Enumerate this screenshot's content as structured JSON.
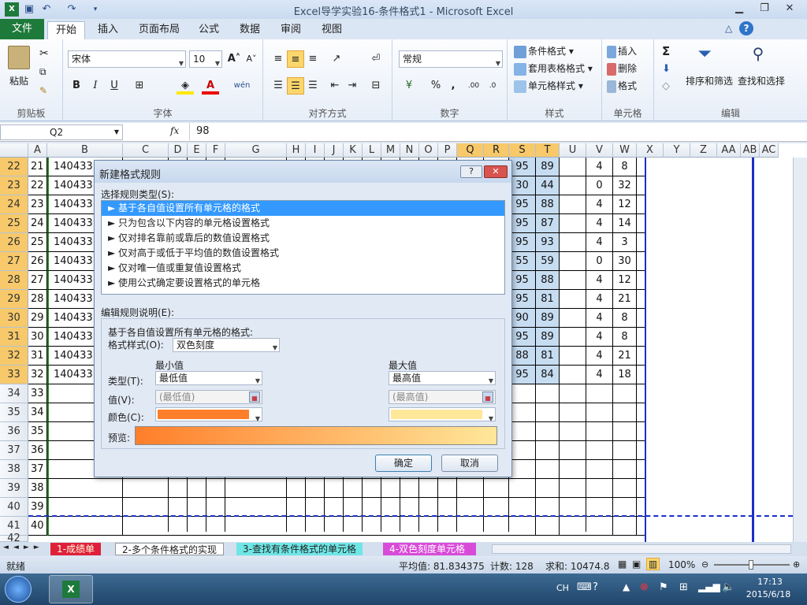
{
  "window": {
    "title": "Excel导学实验16-条件格式1  -  Microsoft Excel"
  },
  "tabs": [
    "文件",
    "开始",
    "插入",
    "页面布局",
    "公式",
    "数据",
    "审阅",
    "视图"
  ],
  "ribbon": {
    "clipboard": {
      "label": "剪贴板",
      "paste": "粘贴"
    },
    "font": {
      "label": "字体",
      "name": "宋体",
      "size": "10",
      "bold": "B",
      "italic": "I",
      "underline": "U"
    },
    "align": {
      "label": "对齐方式"
    },
    "number": {
      "label": "数字",
      "format": "常规",
      "percent": "%",
      "comma": ","
    },
    "styles": {
      "label": "样式",
      "cond": "条件格式",
      "table": "套用表格格式",
      "cell": "单元格样式"
    },
    "cells": {
      "label": "单元格",
      "insert": "插入",
      "delete": "删除",
      "format": "格式"
    },
    "edit": {
      "label": "编辑",
      "sum": "Σ",
      "sort": "排序和筛选",
      "find": "查找和选择"
    }
  },
  "formula_bar": {
    "name_box": "Q2",
    "fx": "fx",
    "value": "98"
  },
  "columns": [
    "A",
    "B",
    "C",
    "D",
    "E",
    "F",
    "G",
    "H",
    "I",
    "J",
    "K",
    "L",
    "M",
    "N",
    "O",
    "P",
    "Q",
    "R",
    "S",
    "T",
    "U",
    "V",
    "W",
    "X",
    "Y",
    "Z",
    "AA",
    "AB",
    "AC"
  ],
  "rows": [
    {
      "r": "22",
      "a": "21",
      "b": "140433",
      "s": "95",
      "t": "89",
      "v": "4",
      "w": "8"
    },
    {
      "r": "23",
      "a": "22",
      "b": "140433",
      "s": "30",
      "t": "44",
      "v": "0",
      "w": "32"
    },
    {
      "r": "24",
      "a": "23",
      "b": "140433",
      "s": "95",
      "t": "88",
      "v": "4",
      "w": "12"
    },
    {
      "r": "25",
      "a": "24",
      "b": "140433",
      "s": "95",
      "t": "87",
      "v": "4",
      "w": "14"
    },
    {
      "r": "26",
      "a": "25",
      "b": "140433",
      "s": "95",
      "t": "93",
      "v": "4",
      "w": "3"
    },
    {
      "r": "27",
      "a": "26",
      "b": "140433",
      "s": "55",
      "t": "59",
      "v": "0",
      "w": "30"
    },
    {
      "r": "28",
      "a": "27",
      "b": "140433",
      "s": "95",
      "t": "88",
      "v": "4",
      "w": "12"
    },
    {
      "r": "29",
      "a": "28",
      "b": "140433",
      "s": "95",
      "t": "81",
      "v": "4",
      "w": "21"
    },
    {
      "r": "30",
      "a": "29",
      "b": "140433",
      "s": "90",
      "t": "89",
      "v": "4",
      "w": "8"
    },
    {
      "r": "31",
      "a": "30",
      "b": "140433",
      "s": "95",
      "t": "89",
      "v": "4",
      "w": "8"
    },
    {
      "r": "32",
      "a": "31",
      "b": "140433",
      "s": "88",
      "t": "81",
      "v": "4",
      "w": "21"
    },
    {
      "r": "33",
      "a": "32",
      "b": "140433",
      "s": "95",
      "t": "84",
      "v": "4",
      "w": "18"
    },
    {
      "r": "34",
      "a": "33"
    },
    {
      "r": "35",
      "a": "34"
    },
    {
      "r": "36",
      "a": "35"
    },
    {
      "r": "37",
      "a": "36"
    },
    {
      "r": "38",
      "a": "37"
    },
    {
      "r": "39",
      "a": "38"
    },
    {
      "r": "40",
      "a": "39"
    },
    {
      "r": "41",
      "a": "40"
    },
    {
      "r": "42",
      "a": ""
    }
  ],
  "dialog": {
    "title": "新建格式规则",
    "help": "?",
    "close": "✕",
    "select_label": "选择规则类型(S):",
    "rule_types": [
      "► 基于各自值设置所有单元格的格式",
      "► 只为包含以下内容的单元格设置格式",
      "► 仅对排名靠前或靠后的数值设置格式",
      "► 仅对高于或低于平均值的数值设置格式",
      "► 仅对唯一值或重复值设置格式",
      "► 使用公式确定要设置格式的单元格"
    ],
    "edit_label": "编辑规则说明(E):",
    "desc_title": "基于各自值设置所有单元格的格式:",
    "format_style_label": "格式样式(O):",
    "format_style": "双色刻度",
    "min_label": "最小值",
    "max_label": "最大值",
    "type_label": "类型(T):",
    "value_label": "值(V):",
    "color_label": "颜色(C):",
    "min_type": "最低值",
    "max_type": "最高值",
    "min_value": "(最低值)",
    "max_value": "(最高值)",
    "min_color": "#ff7e2a",
    "max_color": "#ffe79a",
    "preview_label": "预览:",
    "ok": "确定",
    "cancel": "取消"
  },
  "sheet_tabs": [
    "1-成绩单",
    "2-多个条件格式的实现",
    "3-查找有条件格式的单元格",
    "4-双色刻度单元格"
  ],
  "status": {
    "ready": "就绪",
    "avg": "平均值: 81.834375",
    "count": "计数: 128",
    "sum": "求和: 10474.8",
    "zoom": "100%"
  },
  "taskbar": {
    "lang": "CH",
    "time": "17:13",
    "date": "2015/6/18"
  }
}
